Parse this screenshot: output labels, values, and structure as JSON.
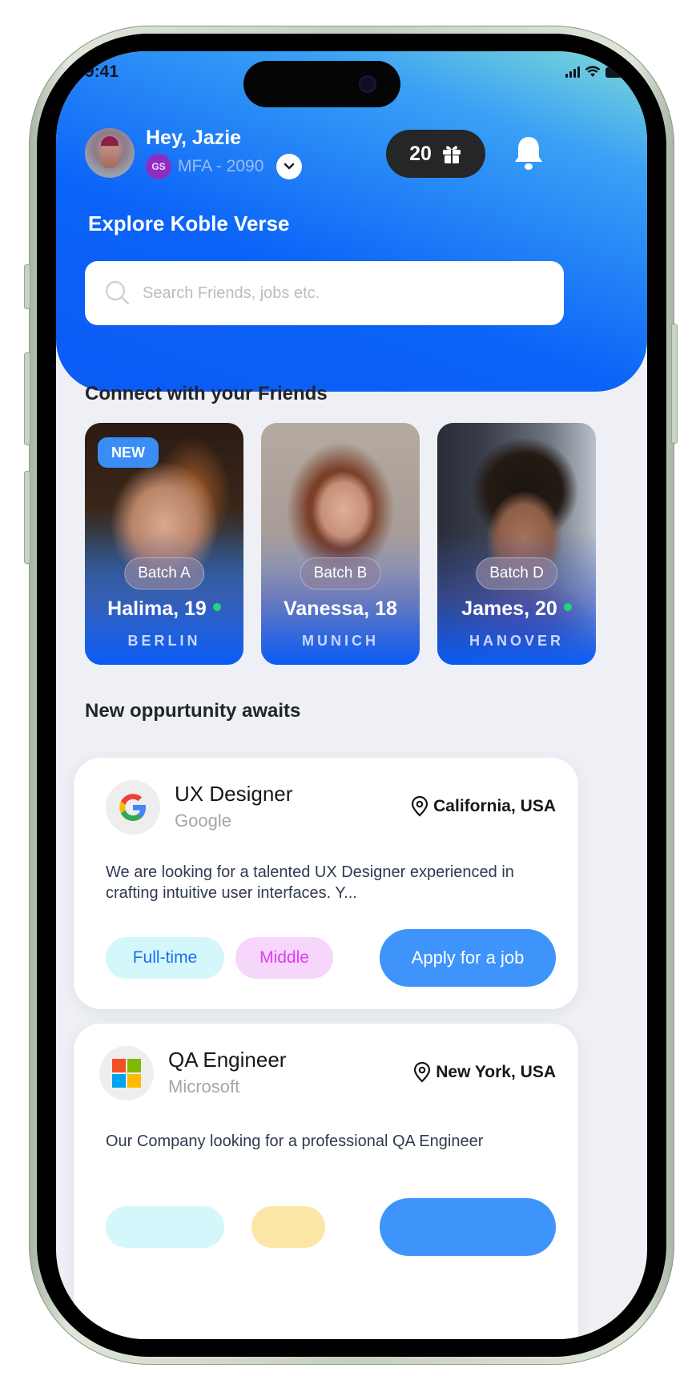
{
  "status_bar": {
    "time": "9:41"
  },
  "header": {
    "greeting": "Hey, Jazie",
    "org_badge": "GS",
    "org_code": "MFA - 2090",
    "points": "20",
    "explore_title": "Explore Koble Verse",
    "search_placeholder": "Search Friends, jobs etc."
  },
  "friends": {
    "section_title": "Connect with your Friends",
    "new_label": "NEW",
    "cards": [
      {
        "name": "Halima, 19",
        "batch": "Batch A",
        "city": "BERLIN",
        "online": true,
        "is_new": true
      },
      {
        "name": "Vanessa, 18",
        "batch": "Batch B",
        "city": "MUNICH",
        "online": false,
        "is_new": false
      },
      {
        "name": "James, 20",
        "batch": "Batch D",
        "city": "HANOVER",
        "online": true,
        "is_new": false
      }
    ]
  },
  "jobs": {
    "section_title": "New oppurtunity awaits",
    "items": [
      {
        "title": "UX Designer",
        "company": "Google",
        "location": "California, USA",
        "description": "We are looking for a talented UX Designer experienced in crafting intuitive user interfaces. Y...",
        "tags": [
          "Full-time",
          "Middle"
        ],
        "apply_label": "Apply for a job"
      },
      {
        "title": "QA Engineer",
        "company": "Microsoft",
        "location": "New York, USA",
        "description": "Our Company looking for a professional QA Engineer",
        "tags": [
          "",
          ""
        ],
        "apply_label": ""
      }
    ]
  },
  "colors": {
    "accent_blue": "#0b63f8",
    "apply_blue": "#3e94fb",
    "online_green": "#22d47a",
    "org_purple": "#8e2ec0"
  }
}
